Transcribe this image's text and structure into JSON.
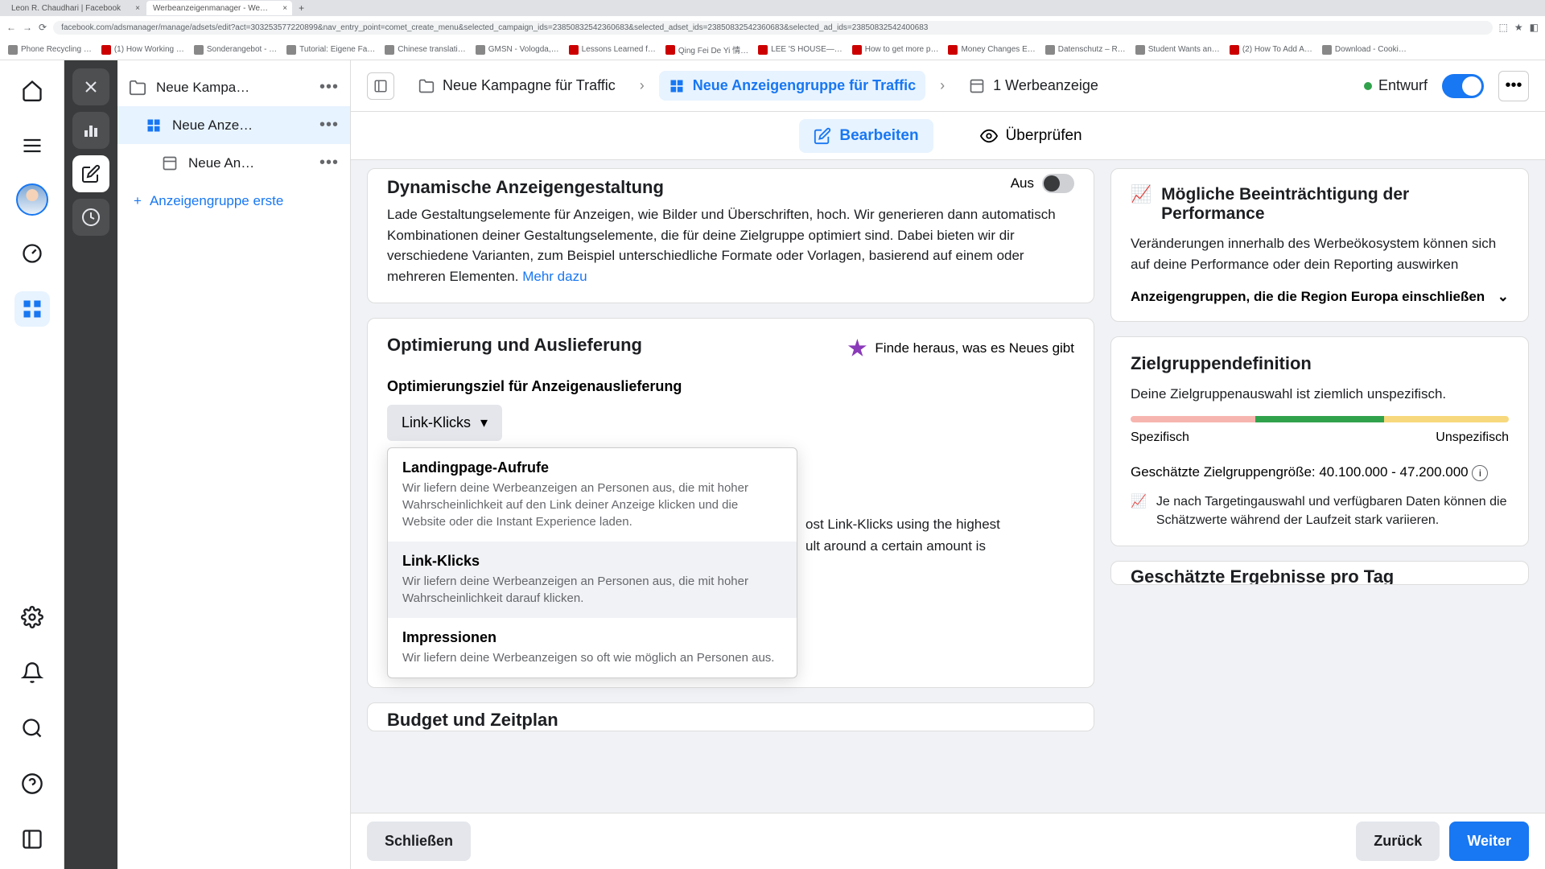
{
  "browser": {
    "tabs": [
      {
        "title": "Leon R. Chaudhari | Facebook"
      },
      {
        "title": "Werbeanzeigenmanager - We…"
      }
    ],
    "url": "facebook.com/adsmanager/manage/adsets/edit?act=303253577220899&nav_entry_point=comet_create_menu&selected_campaign_ids=23850832542360683&selected_adset_ids=23850832542360683&selected_ad_ids=23850832542400683",
    "bookmarks": [
      "Phone Recycling …",
      "(1) How Working …",
      "Sonderangebot - …",
      "Tutorial: Eigene Fa…",
      "Chinese translati…",
      "GMSN - Vologda,…",
      "Lessons Learned f…",
      "Qing Fei De Yi 情…",
      "LEE 'S HOUSE—…",
      "How to get more p…",
      "Money Changes E…",
      "Datenschutz – R…",
      "Student Wants an…",
      "(2) How To Add A…",
      "Download - Cooki…"
    ]
  },
  "tree": {
    "campaign": "Neue Kampa…",
    "adset": "Neue Anze…",
    "ad": "Neue An…",
    "add": "Anzeigengruppe erste"
  },
  "breadcrumb": {
    "campaign": "Neue Kampagne für Traffic",
    "adset": "Neue Anzeigengruppe für Traffic",
    "ad": "1 Werbeanzeige",
    "status": "Entwurf"
  },
  "tabs": {
    "edit": "Bearbeiten",
    "review": "Überprüfen"
  },
  "dynamic": {
    "title": "Dynamische Anzeigengestaltung",
    "off": "Aus",
    "body": "Lade Gestaltungselemente für Anzeigen, wie Bilder und Überschriften, hoch. Wir generieren dann automatisch Kombinationen deiner Gestaltungselemente, die für deine Zielgruppe optimiert sind. Dabei bieten wir dir verschiedene Varianten, zum Beispiel unterschiedliche Formate oder Vorlagen, basierend auf einem oder mehreren Elementen. ",
    "more": "Mehr dazu"
  },
  "opt": {
    "title": "Optimierung und Auslieferung",
    "news": "Finde heraus, was es Neues gibt",
    "goalLabel": "Optimierungsziel für Anzeigenauslieferung",
    "selected": "Link-Klicks",
    "behind1": "ost Link-Klicks using the highest",
    "behind2": "ult around a certain amount is",
    "options": [
      {
        "title": "Landingpage-Aufrufe",
        "desc": "Wir liefern deine Werbeanzeigen an Personen aus, die mit hoher Wahrscheinlichkeit auf den Link deiner Anzeige klicken und die Website oder die Instant Experience laden."
      },
      {
        "title": "Link-Klicks",
        "desc": "Wir liefern deine Werbeanzeigen an Personen aus, die mit hoher Wahrscheinlichkeit darauf klicken."
      },
      {
        "title": "Impressionen",
        "desc": "Wir liefern deine Werbeanzeigen so oft wie möglich an Personen aus."
      }
    ]
  },
  "budget": {
    "title": "Budget und Zeitplan"
  },
  "perf": {
    "title": "Mögliche Beeinträchtigung der Performance",
    "body": "Veränderungen innerhalb des Werbeökosystem können sich auf deine Performance oder dein Reporting auswirken",
    "row": "Anzeigengruppen, die die Region Europa einschließen"
  },
  "aud": {
    "title": "Zielgruppendefinition",
    "msg": "Deine Zielgruppenauswahl ist ziemlich unspezifisch.",
    "left": "Spezifisch",
    "right": "Unspezifisch",
    "est": "Geschätzte Zielgruppengröße: 40.100.000 - 47.200.000",
    "note": "Je nach Targetingauswahl und verfügbaren Daten können die Schätzwerte während der Laufzeit stark variieren."
  },
  "results": {
    "title": "Geschätzte Ergebnisse pro Tag"
  },
  "footer": {
    "close": "Schließen",
    "back": "Zurück",
    "next": "Weiter"
  }
}
